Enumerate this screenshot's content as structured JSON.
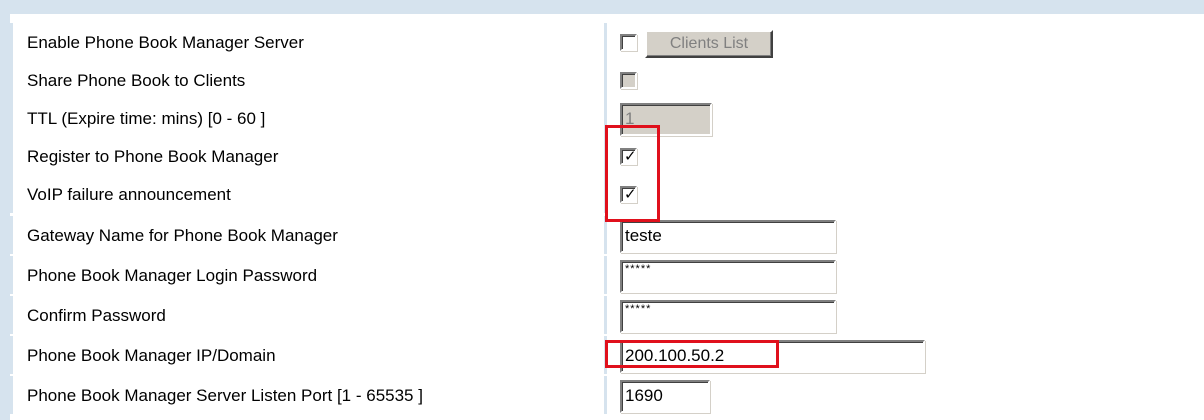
{
  "colors": {
    "page_background": "#d6e3ee",
    "highlight": "#e0101c",
    "control_face": "#d4d0c8"
  },
  "rows": [
    {
      "label": "Enable Phone Book Manager Server",
      "control": "checkbox",
      "checked": false,
      "disabled": false,
      "button_label": "Clients List",
      "button_disabled": true
    },
    {
      "label": "Share Phone Book to Clients",
      "control": "checkbox",
      "checked": false,
      "disabled": true
    },
    {
      "label": "TTL (Expire time: mins) [0 - 60 ]",
      "control": "text",
      "value": "1",
      "disabled": true
    },
    {
      "label": "Register to Phone Book Manager",
      "control": "checkbox",
      "checked": true,
      "disabled": false
    },
    {
      "label": "VoIP failure announcement",
      "control": "checkbox",
      "checked": true,
      "disabled": false
    },
    {
      "label": "Gateway Name for Phone Book Manager",
      "control": "text",
      "value": "teste"
    },
    {
      "label": "Phone Book Manager Login Password",
      "control": "password",
      "value": "*****"
    },
    {
      "label": "Confirm Password",
      "control": "password",
      "value": "*****"
    },
    {
      "label": "Phone Book Manager IP/Domain",
      "control": "text",
      "value": "200.100.50.2"
    },
    {
      "label": "Phone Book Manager Server Listen Port [1 - 65535 ]",
      "control": "text",
      "value": "1690"
    }
  ],
  "tick_glyph": "✓"
}
